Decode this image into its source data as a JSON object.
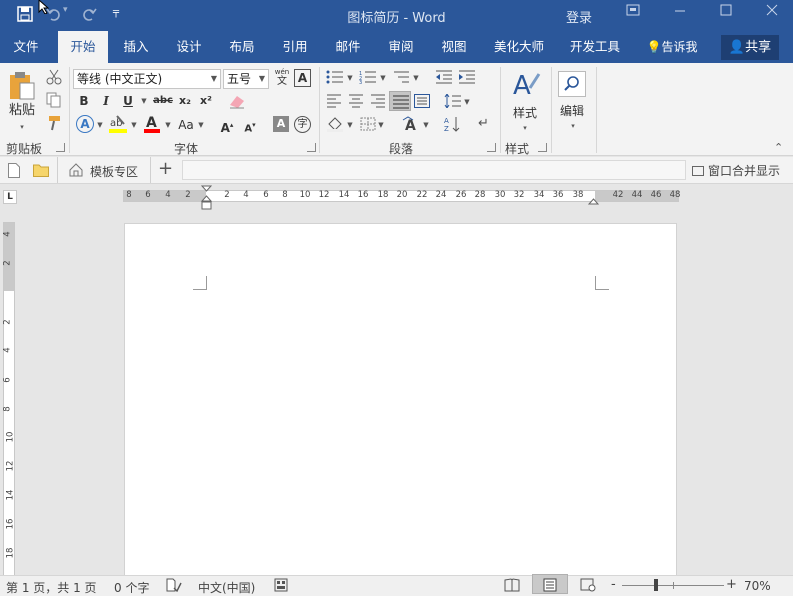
{
  "title_bar": {
    "document_title": "图标简历 - Word",
    "signin_label": "登录",
    "save_icon": "save-icon",
    "undo_icon": "undo-icon",
    "redo_icon": "redo-icon",
    "customize_icon": "customize-qat-icon"
  },
  "tabs": [
    "文件",
    "开始",
    "插入",
    "设计",
    "布局",
    "引用",
    "邮件",
    "审阅",
    "视图",
    "美化大师",
    "开发工具"
  ],
  "tell_me": "告诉我",
  "share_label": "共享",
  "ribbon": {
    "clipboard": {
      "paste_label": "粘贴",
      "group_label": "剪贴板"
    },
    "font": {
      "font_name": "等线 (中文正文)",
      "font_size": "五号",
      "wen_label": "wén",
      "wen_char": "文",
      "bold": "B",
      "italic": "I",
      "underline": "U",
      "strike": "abc",
      "subscript": "x₂",
      "superscript": "x²",
      "change_case": "Aa",
      "grow": "A",
      "shrink": "A",
      "group_label": "字体"
    },
    "paragraph": {
      "group_label": "段落"
    },
    "styles": {
      "label": "样式",
      "group_label": "样式"
    },
    "editing": {
      "label": "编辑"
    }
  },
  "doc_tabs": {
    "template_tab": "模板专区",
    "window_merge": "窗口合并显示"
  },
  "ruler": {
    "horizontal": [
      "8",
      "6",
      "4",
      "2",
      "2",
      "4",
      "6",
      "8",
      "10",
      "12",
      "14",
      "16",
      "18",
      "20",
      "22",
      "24",
      "26",
      "28",
      "30",
      "32",
      "34",
      "36",
      "38",
      "42",
      "44",
      "46",
      "48"
    ],
    "vertical": [
      "4",
      "2",
      "2",
      "4",
      "6",
      "8",
      "10",
      "12",
      "14",
      "16",
      "18"
    ]
  },
  "status": {
    "page": "第 1 页，共 1 页",
    "words": "0 个字",
    "language": "中文(中国)",
    "zoom_minus": "-",
    "zoom_plus": "+",
    "zoom_level": "70%"
  },
  "colors": {
    "brand_blue": "#2b579a",
    "highlight_yellow": "#ffff00",
    "font_red": "#ff0000"
  }
}
